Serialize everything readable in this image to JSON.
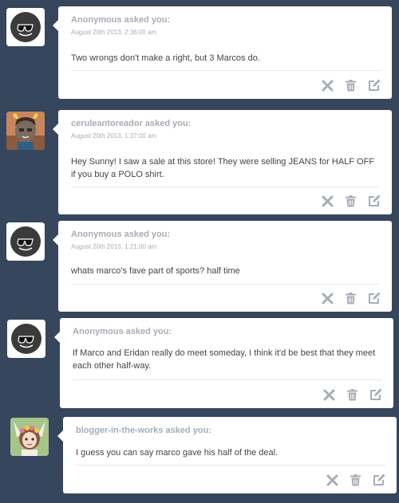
{
  "posts": [
    {
      "asker": "Anonymous asked you:",
      "date": "August 20th 2013, 2:36:00 am",
      "question": "Two wrongs don't make a right, but 3 Marcos do.",
      "avatar_icon": "anonymous-sunglasses-avatar"
    },
    {
      "asker": "ceruleantoreador asked you:",
      "date": "August 20th 2013, 1:37:00 am",
      "question": "Hey Sunny! I saw a sale at this store! They were selling JEANS for HALF OFF if you buy a POLO shirt.",
      "avatar_icon": "character-avatar-horns"
    },
    {
      "asker": "Anonymous asked you:",
      "date": "August 20th 2013, 1:21:00 am",
      "question": "whats marco's fave part of sports? half time",
      "avatar_icon": "anonymous-sunglasses-avatar"
    },
    {
      "asker": "Anonymous asked you:",
      "date": "",
      "question": "If Marco and Eridan really do meet someday, I think it'd be best that they meet each other half-way.",
      "avatar_icon": "anonymous-sunglasses-avatar"
    },
    {
      "asker": "blogger-in-the-works asked you:",
      "date": "",
      "question": "I guess you can say marco gave his half of the deal.",
      "avatar_icon": "character-avatar-flower-crown"
    }
  ],
  "actions": {
    "delete_icon": "x-icon",
    "trash_icon": "trash-icon",
    "answer_icon": "edit-icon"
  },
  "colors": {
    "background": "#36465d",
    "card": "#ffffff",
    "muted_text": "#a7adb6",
    "body_text": "#444444",
    "icon": "#a7adb6"
  }
}
